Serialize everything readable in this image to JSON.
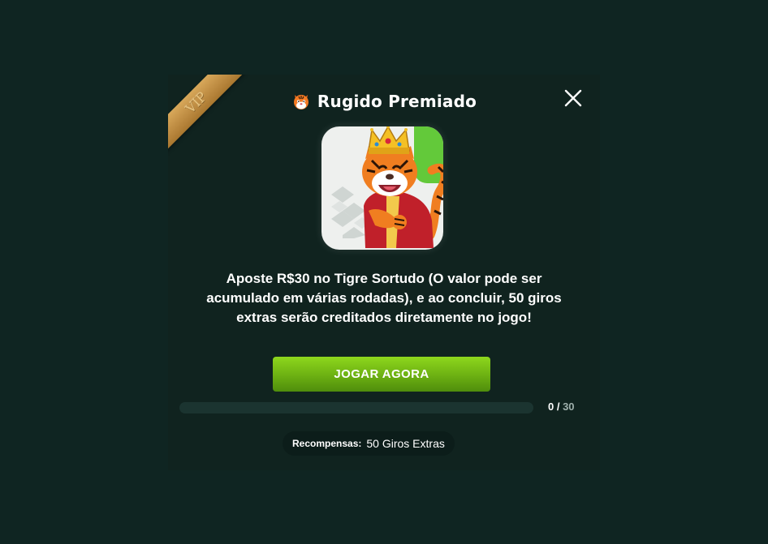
{
  "modal": {
    "vip_label": "VIP",
    "title": "Rugido Premiado",
    "title_icon": "tiger-face-icon",
    "close_icon": "close-icon",
    "game_image": "tigre-sortudo-game-tile",
    "description": "Aposte R$30 no Tigre Sortudo (O valor pode ser acumulado em várias rodadas), e ao concluir, 50 giros extras serão creditados diretamente no jogo!",
    "play_button_label": "JOGAR AGORA",
    "progress": {
      "current": "0",
      "separator": " / ",
      "total": "30",
      "fraction": 0
    },
    "reward": {
      "label": "Recompensas:",
      "value": "50 Giros Extras"
    }
  },
  "colors": {
    "background": "#0f2522",
    "modal_bg": "#10231f",
    "accent_green": "#6cb012",
    "vip_gold": "#c18f45",
    "text": "#ffffff",
    "muted_text": "#9fb0ac"
  }
}
